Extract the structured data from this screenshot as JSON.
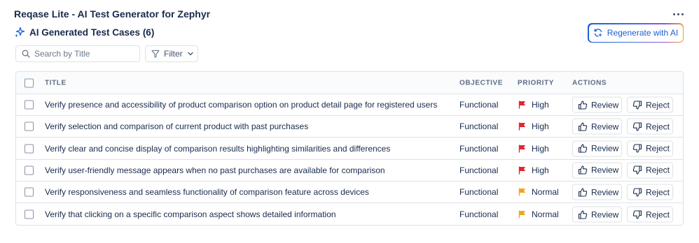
{
  "app": {
    "title": "Reqase Lite - AI Test Generator for Zephyr"
  },
  "section": {
    "title": "AI Generated Test Cases (6)"
  },
  "toolbar": {
    "regenerate_label": "Regenerate with AI",
    "search_placeholder": "Search by Title",
    "filter_label": "Filter"
  },
  "colors": {
    "accent": "#1d5fd6",
    "priority_high": "#e5242b",
    "priority_normal": "#f2a516"
  },
  "table": {
    "headers": {
      "title": "TITLE",
      "objective": "OBJECTIVE",
      "priority": "PRIORITY",
      "actions": "ACTIONS"
    },
    "review_label": "Review",
    "reject_label": "Reject",
    "rows": [
      {
        "title": "Verify presence and accessibility of product comparison option on product detail page for registered users",
        "objective": "Functional",
        "priority": "High",
        "flag": "flag-red-icon"
      },
      {
        "title": "Verify selection and comparison of current product with past purchases",
        "objective": "Functional",
        "priority": "High",
        "flag": "flag-red-icon"
      },
      {
        "title": "Verify clear and concise display of comparison results highlighting similarities and differences",
        "objective": "Functional",
        "priority": "High",
        "flag": "flag-red-icon"
      },
      {
        "title": "Verify user-friendly message appears when no past purchases are available for comparison",
        "objective": "Functional",
        "priority": "High",
        "flag": "flag-red-icon"
      },
      {
        "title": "Verify responsiveness and seamless functionality of comparison feature across devices",
        "objective": "Functional",
        "priority": "Normal",
        "flag": "flag-yellow-icon"
      },
      {
        "title": "Verify that clicking on a specific comparison aspect shows detailed information",
        "objective": "Functional",
        "priority": "Normal",
        "flag": "flag-yellow-icon"
      }
    ]
  }
}
